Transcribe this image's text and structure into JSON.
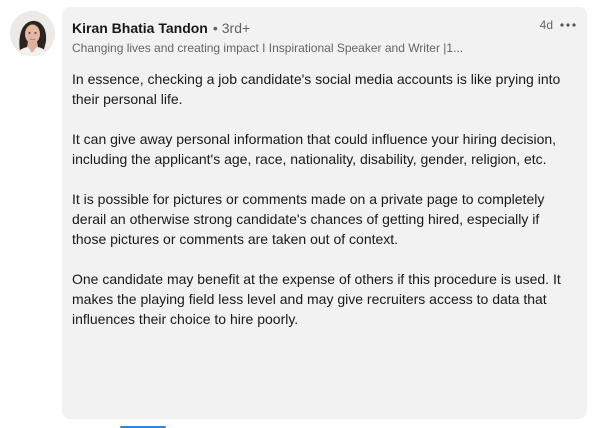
{
  "comment": {
    "author_name": "Kiran Bhatia Tandon",
    "bullet": "•",
    "connection_degree": "3rd+",
    "headline": "Changing lives and creating impact I Inspirational Speaker and Writer |1...",
    "timestamp": "4d",
    "more_icon": "ellipsis-icon",
    "paragraphs": [
      "In essence, checking a job candidate's social media accounts is like prying into their personal life.",
      "It can give away personal information that could influence your hiring decision, including the applicant's age, race, nationality, disability, gender, religion, etc.",
      "It is possible for pictures or comments made on a private page to completely derail an otherwise strong candidate's chances of getting hired, especially if those pictures or comments are taken out of context.",
      "One candidate may benefit at the expense of others if this procedure is used. It makes the playing field less level and may give recruiters access to data that influences their choice to hire poorly."
    ]
  },
  "colors": {
    "bubble_background": "#f2f2f2",
    "link_blue": "#0a66c2"
  }
}
